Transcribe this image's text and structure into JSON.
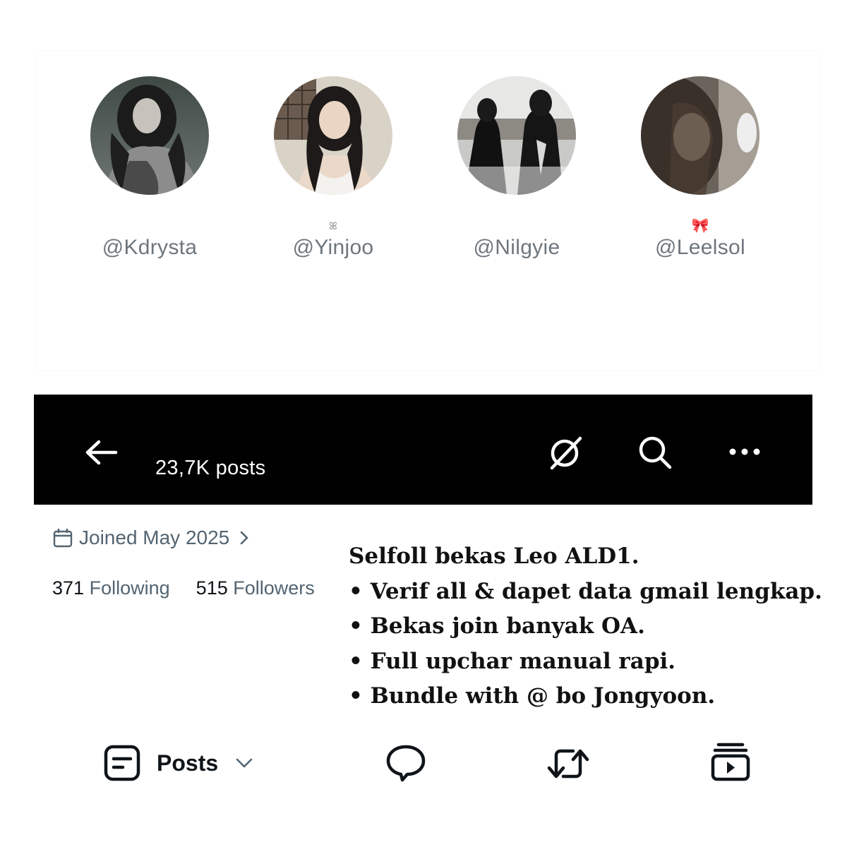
{
  "accounts": [
    {
      "handle": "@Kdrysta",
      "deco": "",
      "avatar": "avatar-grey-coat"
    },
    {
      "handle": "@Yinjoo",
      "deco": "ꕤ",
      "avatar": "avatar-white-top"
    },
    {
      "handle": "@Nilgyie",
      "deco": "",
      "avatar": "avatar-black-dress"
    },
    {
      "handle": "@Leelsol",
      "deco": "🎀",
      "avatar": "avatar-dark-hair"
    }
  ],
  "profile_header": {
    "posts_count": "23,7K posts",
    "icons": [
      "back-arrow-icon",
      "grok-icon",
      "search-icon",
      "more-icon"
    ]
  },
  "profile": {
    "joined": "Joined May 2025",
    "following_count": "371",
    "following_label": "Following",
    "followers_count": "515",
    "followers_label": "Followers"
  },
  "bio": {
    "lines": [
      "Selfoll bekas Leo ALD1.",
      "• Verif all & dapet data gmail lengkap.",
      "• Bekas join banyak OA.",
      "• Full upchar manual rapi.",
      "• Bundle with @ bo Jongyoon."
    ]
  },
  "tabs": {
    "posts_label": "Posts",
    "icons": [
      "posts-icon",
      "chevron-down-icon",
      "reply-icon",
      "repost-icon",
      "media-icon"
    ]
  },
  "colors": {
    "header_bg": "#000000",
    "secondary_text": "#536471",
    "handle_text": "#6e767d"
  }
}
